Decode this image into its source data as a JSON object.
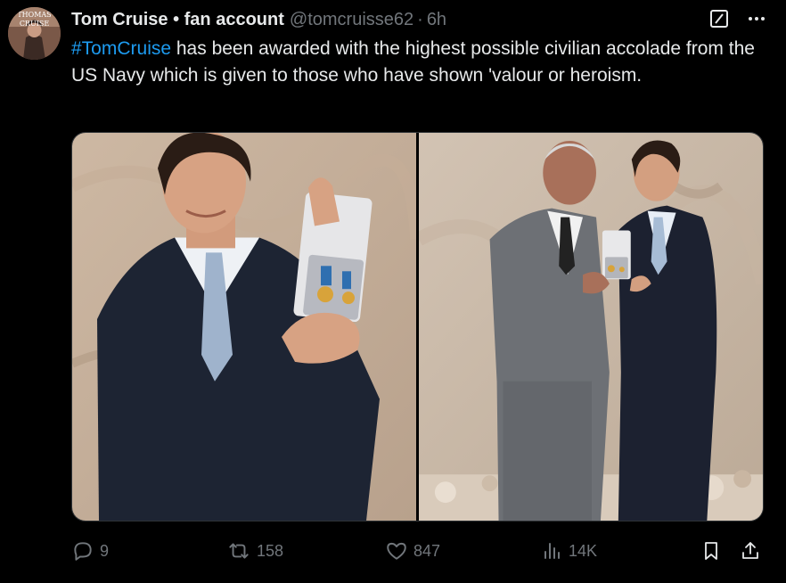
{
  "author": {
    "display_name": "Tom Cruise • fan account",
    "handle": "@tomcruisse62",
    "separator": "·",
    "time": "6h",
    "avatar_text_top": "THOMAS",
    "avatar_text_bottom": "CRUISE"
  },
  "tweet": {
    "hashtag": "#TomCruise",
    "text": " has been awarded with the highest possible civilian accolade from the US Navy which is given to those who have shown 'valour or heroism."
  },
  "actions": {
    "replies": "9",
    "reposts": "158",
    "likes": "847",
    "views": "14K"
  },
  "colors": {
    "background": "#000000",
    "text": "#e7e9ea",
    "muted": "#71767b",
    "accent": "#1d9bf0"
  },
  "icons": {
    "grok": "grok-icon",
    "more": "more-icon",
    "reply": "reply-icon",
    "repost": "repost-icon",
    "like": "heart-icon",
    "views": "views-icon",
    "bookmark": "bookmark-icon",
    "share": "share-icon"
  }
}
